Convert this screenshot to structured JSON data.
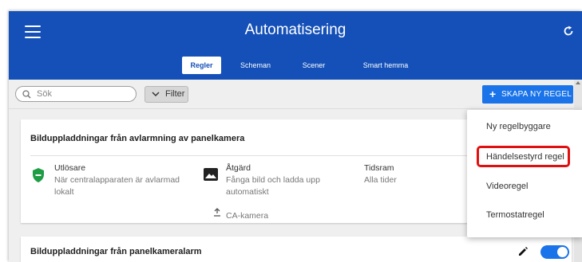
{
  "header": {
    "title": "Automatisering",
    "tabs": [
      {
        "label": "Regler",
        "active": true
      },
      {
        "label": "Scheman",
        "active": false
      },
      {
        "label": "Scener",
        "active": false
      },
      {
        "label": "Smart hemma",
        "active": false
      }
    ]
  },
  "toolbar": {
    "search_placeholder": "Sök",
    "filter_label": "Filter",
    "create_label": "SKAPA NY REGEL"
  },
  "create_menu": {
    "items": [
      "Ny regelbyggare",
      "Händelsestyrd regel",
      "Videoregel",
      "Termostatregel"
    ],
    "highlighted": "Händelsestyrd regel"
  },
  "rules": [
    {
      "title": "Bilduppladdningar från avlarmning av panelkamera",
      "trigger_head": "Utlösare",
      "trigger_text": "När centralapparaten är avlarmad lokalt",
      "action_head": "Åtgärd",
      "action_text": "Fånga bild och ladda upp automatiskt",
      "action_device": "CA-kamera",
      "time_head": "Tidsram",
      "time_text": "Alla tider"
    },
    {
      "title": "Bilduppladdningar från panelkameralarm",
      "enabled": true
    }
  ],
  "colors": {
    "header": "#1450b8",
    "accent": "#1a73e8",
    "trigger_shield": "#1f9d45",
    "highlight": "#e01010"
  }
}
